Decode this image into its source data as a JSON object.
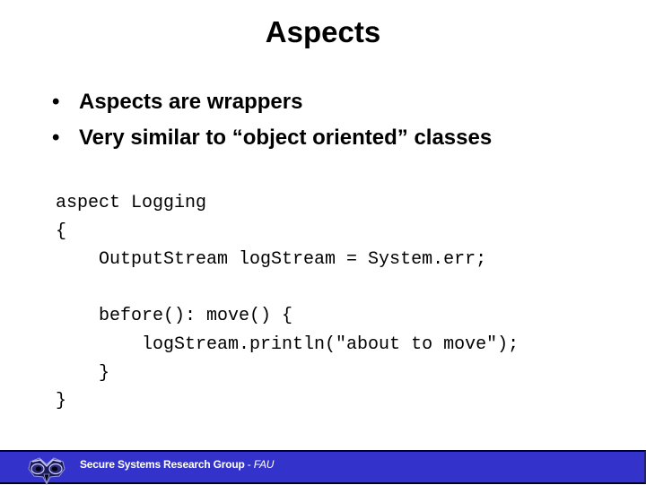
{
  "slide": {
    "title": "Aspects",
    "bullets": [
      {
        "marker": "•",
        "text": "Aspects are wrappers"
      },
      {
        "marker": "•",
        "text": "Very similar to “object oriented” classes"
      }
    ],
    "code_lines": [
      "aspect Logging",
      "{",
      "    OutputStream logStream = System.err;",
      "",
      "    before(): move() {",
      "        logStream.println(\"about to move\");",
      "    }",
      "}"
    ]
  },
  "footer": {
    "logo_icon": "owl-logo-icon",
    "group_name": "Secure Systems Research Group",
    "separator": " - ",
    "institution": "FAU",
    "background_color": "#3333cc",
    "text_color": "#ffffff"
  }
}
